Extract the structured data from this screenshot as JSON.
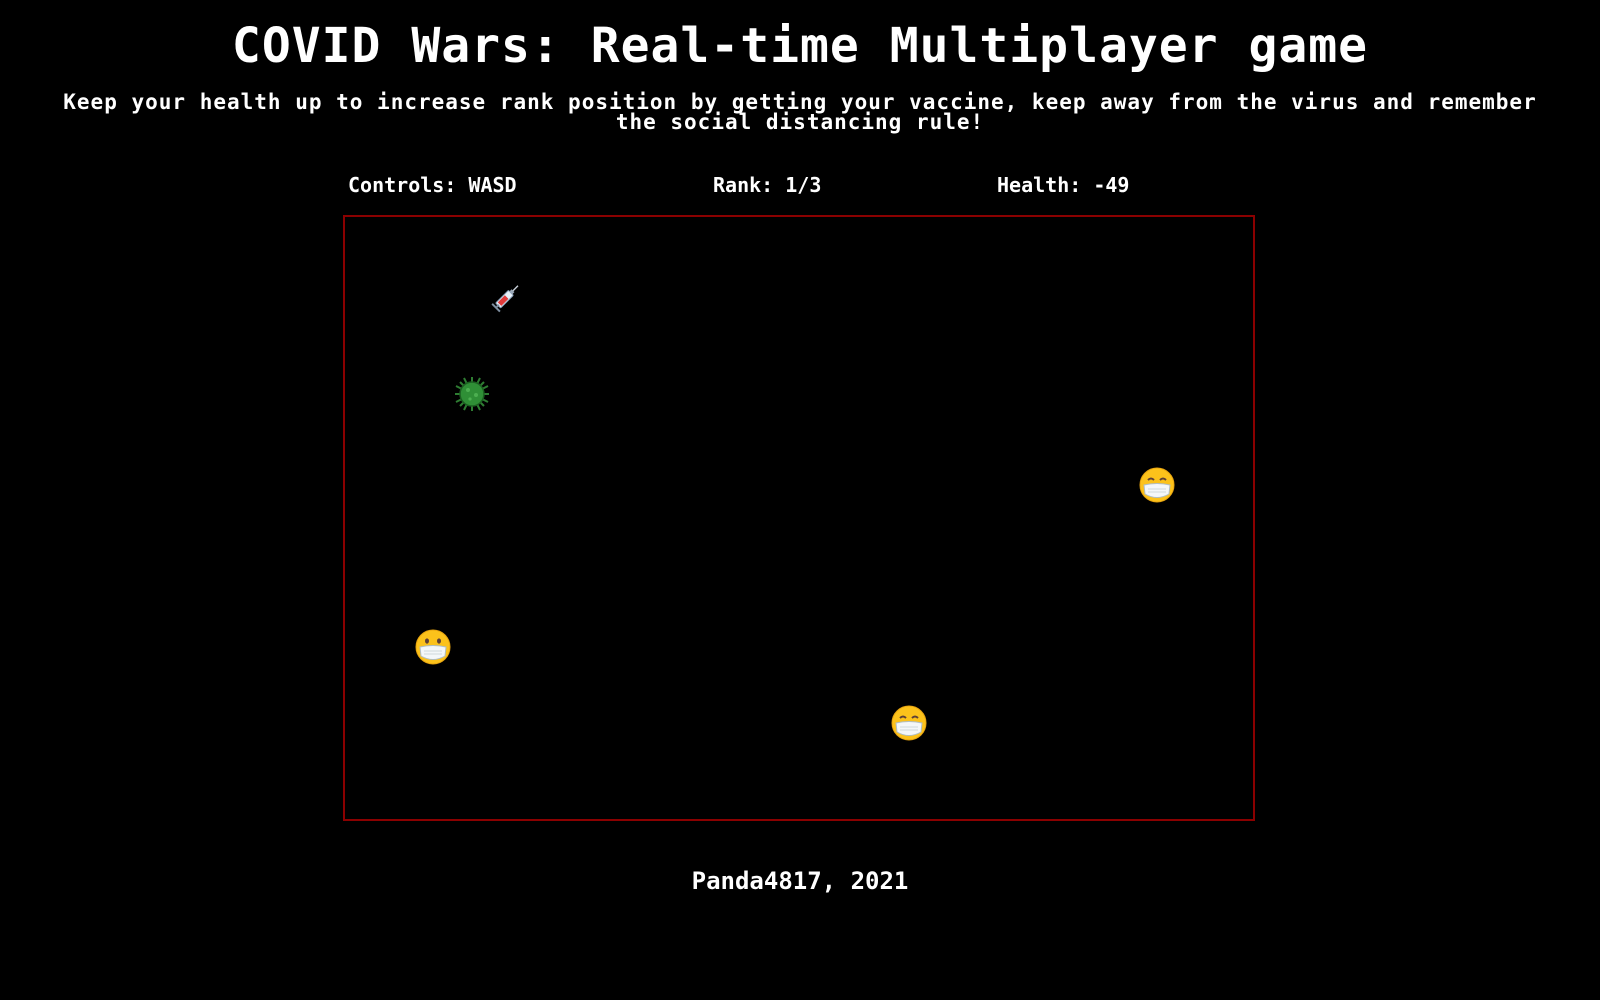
{
  "header": {
    "title": "COVID Wars: Real-time Multiplayer game",
    "subtitle": "Keep your health up to increase rank position by getting your vaccine, keep away from the virus and remember the social distancing rule!"
  },
  "hud": {
    "controls": "Controls: WASD",
    "rank": "Rank: 1/3",
    "health": "Health: -49"
  },
  "arena": {
    "border_color": "#8b0000",
    "background": "#000000",
    "items": [
      {
        "icon": "syringe-icon"
      },
      {
        "icon": "virus-icon"
      },
      {
        "icon": "masked-face-icon"
      },
      {
        "icon": "masked-face-icon"
      },
      {
        "icon": "masked-face-icon"
      }
    ]
  },
  "footer": {
    "credit": "Panda4817, 2021"
  }
}
